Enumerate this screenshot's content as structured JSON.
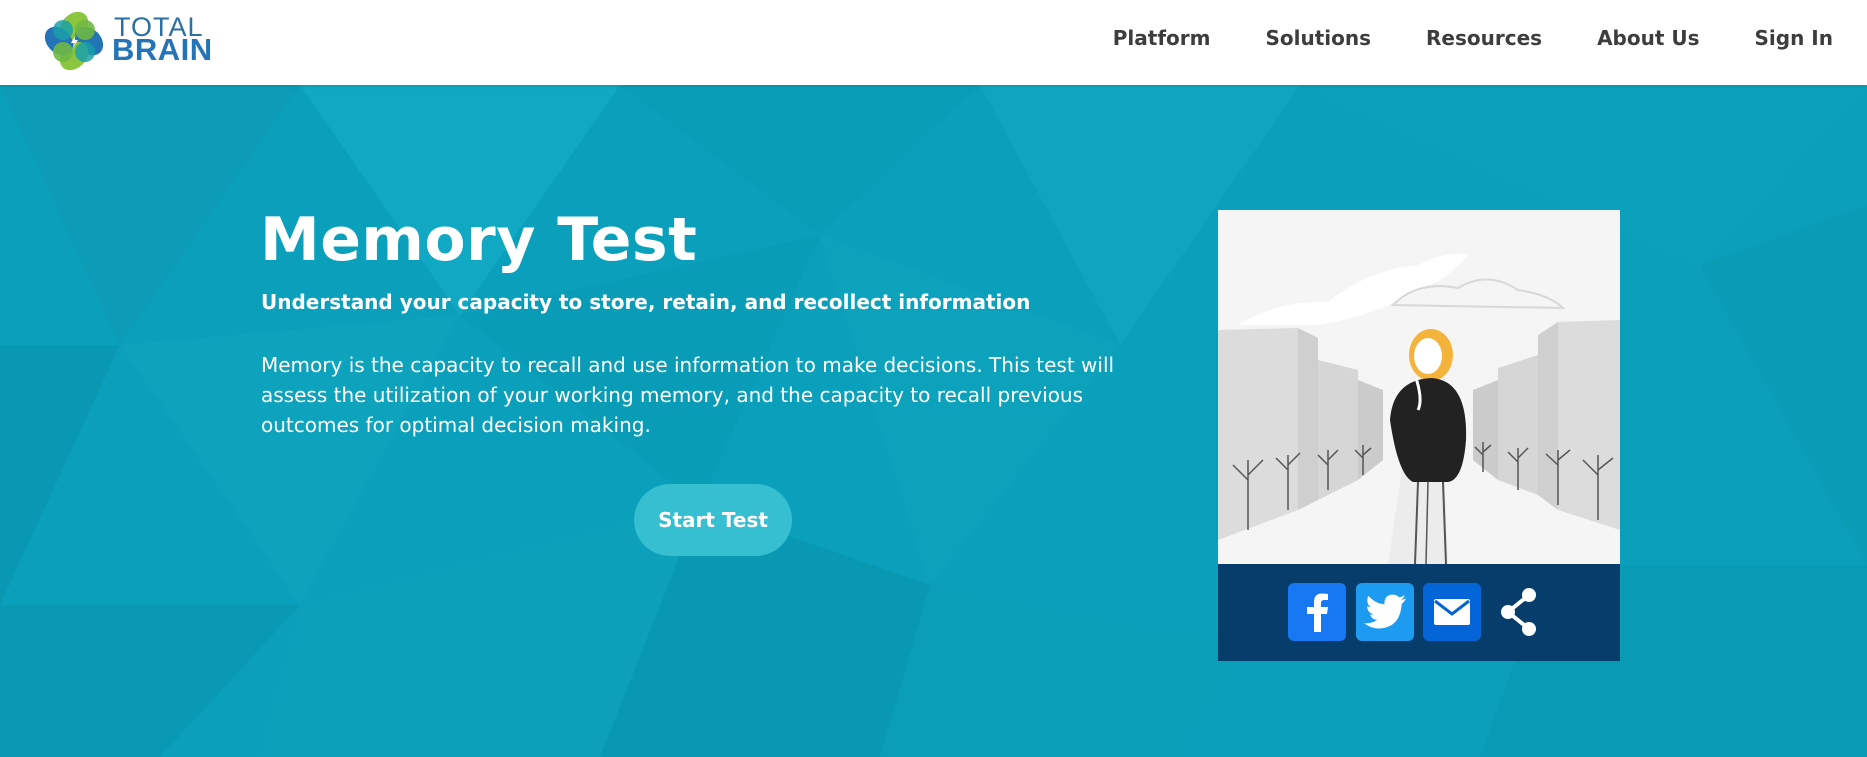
{
  "brand": {
    "name_top": "TOTAL",
    "name_bottom": "BRAIN",
    "colors": {
      "blue": "#2474b8",
      "green": "#8cc63f",
      "teal": "#0aa3bd"
    }
  },
  "nav": {
    "items": [
      {
        "label": "Platform"
      },
      {
        "label": "Solutions"
      },
      {
        "label": "Resources"
      },
      {
        "label": "About Us"
      },
      {
        "label": "Sign In"
      }
    ]
  },
  "hero": {
    "title": "Memory Test",
    "subtitle": "Understand your capacity to store, retain, and recollect information",
    "description": "Memory is the capacity to recall and use information to make decisions. This test will assess the utilization of your working memory, and the capacity to recall previous outcomes for optimal decision making.",
    "start_button": "Start Test",
    "background_color": "#0aa0bb",
    "button_color": "#35bfd0"
  },
  "share": {
    "buttons": [
      {
        "icon": "facebook-icon",
        "color": "#1877f2"
      },
      {
        "icon": "twitter-icon",
        "color": "#1d9bf0"
      },
      {
        "icon": "email-icon",
        "color": "#0466d6"
      },
      {
        "icon": "share-icon",
        "color": "#ffffff"
      }
    ],
    "bar_color": "#063d6b"
  }
}
